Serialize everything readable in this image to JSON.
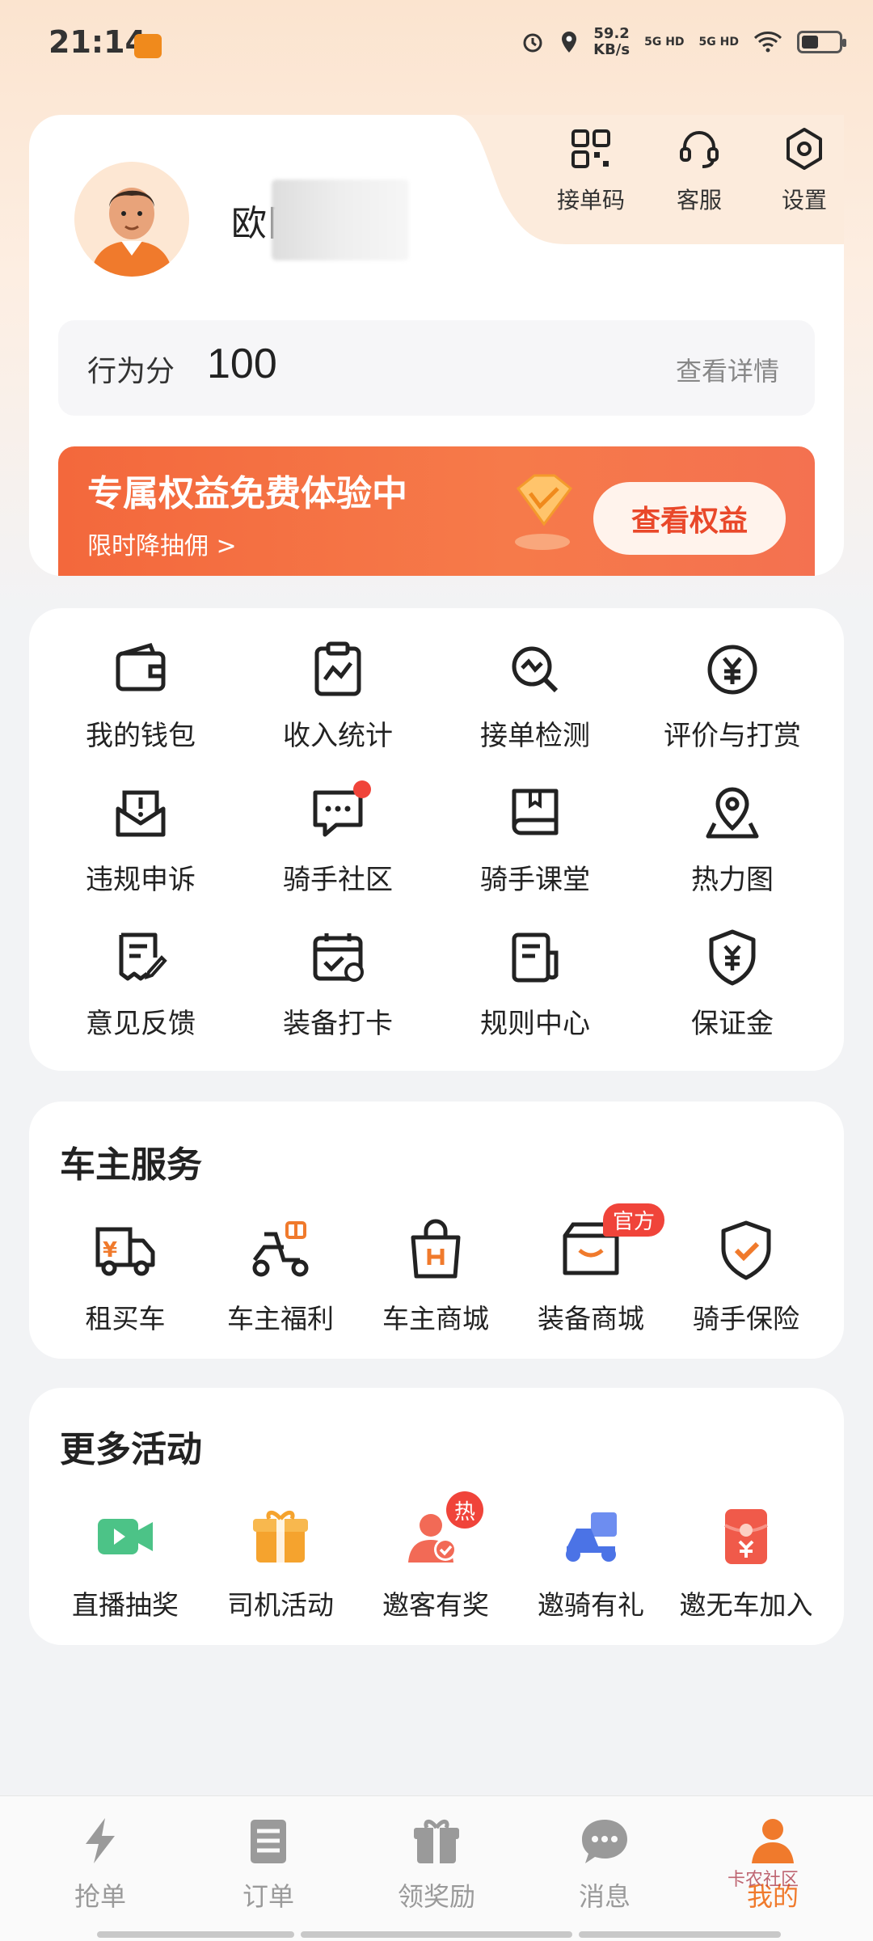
{
  "status_bar": {
    "time": "21:14",
    "speed": "59.2",
    "speed_unit": "KB/s",
    "network1": "5G HD",
    "network2": "5G HD"
  },
  "profile": {
    "name": "欧阝",
    "top_actions": [
      {
        "label": "接单码",
        "icon": "qr-code-icon"
      },
      {
        "label": "客服",
        "icon": "headset-icon"
      },
      {
        "label": "设置",
        "icon": "settings-icon"
      }
    ],
    "score_label": "行为分",
    "score_value": "100",
    "score_detail": "查看详情"
  },
  "promo": {
    "title": "专属权益免费体验中",
    "subtitle": "限时降抽佣 >",
    "button": "查看权益",
    "colors": {
      "bg": "#f3683c",
      "btn_text": "#e9482a"
    }
  },
  "grid": [
    {
      "label": "我的钱包",
      "icon": "wallet-icon"
    },
    {
      "label": "收入统计",
      "icon": "income-chart-icon"
    },
    {
      "label": "接单检测",
      "icon": "order-check-icon"
    },
    {
      "label": "评价与打赏",
      "icon": "yuan-coin-icon"
    },
    {
      "label": "违规申诉",
      "icon": "appeal-icon"
    },
    {
      "label": "骑手社区",
      "icon": "community-chat-icon"
    },
    {
      "label": "骑手课堂",
      "icon": "classroom-book-icon"
    },
    {
      "label": "热力图",
      "icon": "heatmap-pin-icon"
    },
    {
      "label": "意见反馈",
      "icon": "feedback-icon"
    },
    {
      "label": "装备打卡",
      "icon": "calendar-check-icon"
    },
    {
      "label": "规则中心",
      "icon": "rules-doc-icon"
    },
    {
      "label": "保证金",
      "icon": "deposit-shield-icon"
    }
  ],
  "owner_services": {
    "title": "车主服务",
    "items": [
      {
        "label": "租买车",
        "icon": "rent-truck-icon"
      },
      {
        "label": "车主福利",
        "icon": "scooter-gift-icon"
      },
      {
        "label": "车主商城",
        "icon": "shopping-bag-icon"
      },
      {
        "label": "装备商城",
        "icon": "gear-box-icon",
        "badge": "官方"
      },
      {
        "label": "骑手保险",
        "icon": "insurance-shield-icon"
      }
    ]
  },
  "more_activities": {
    "title": "更多活动",
    "items": [
      {
        "label": "直播抽奖",
        "icon": "live-video-icon"
      },
      {
        "label": "司机活动",
        "icon": "gift-box-icon"
      },
      {
        "label": "邀客有奖",
        "icon": "invite-user-icon",
        "badge": "热"
      },
      {
        "label": "邀骑有礼",
        "icon": "invite-rider-icon"
      },
      {
        "label": "邀无车加入",
        "icon": "red-packet-icon"
      }
    ]
  },
  "bottom_nav": [
    {
      "label": "抢单",
      "icon": "lightning-icon"
    },
    {
      "label": "订单",
      "icon": "order-list-icon"
    },
    {
      "label": "领奖励",
      "icon": "reward-gift-icon"
    },
    {
      "label": "消息",
      "icon": "message-bubble-icon"
    },
    {
      "label": "我的",
      "icon": "person-icon",
      "active": true
    }
  ],
  "watermark": "卡农社区"
}
